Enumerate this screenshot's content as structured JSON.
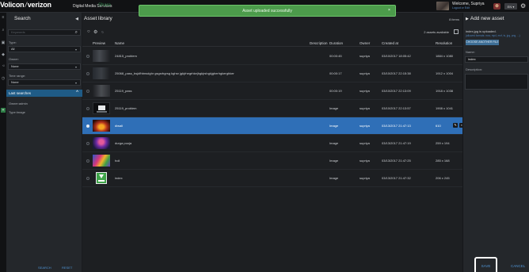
{
  "header": {
    "brand_left": "Volicon",
    "brand_sep": "/",
    "brand_right": "verizon",
    "subtitle": "Digital Media Services",
    "share": "Share",
    "toast": "Asset uploaded successfully",
    "toast_close": "×",
    "welcome": "Welcome, Supriya",
    "welcome_sub": "Logout or Edit",
    "language": "EN ▾",
    "settings_icon": "gear-icon"
  },
  "rail": {
    "icons": [
      "menu-icon",
      "search-icon",
      "chat-icon",
      "tag-icon",
      "share-icon",
      "clock-icon",
      "plus-icon"
    ]
  },
  "search": {
    "title": "Search",
    "keywords_placeholder": "Keywords",
    "type_label": "Type:",
    "type_value": "All",
    "owner_label": "Owner:",
    "owner_value": "None",
    "time_label": "Time range:",
    "time_value": "None",
    "last_searches": "Last searches",
    "last_items": [
      "Owner:admin",
      "Type:Image"
    ],
    "search_button": "SEARCH",
    "reset_button": "RESET"
  },
  "library": {
    "title": "Asset library",
    "items_count": "8 items",
    "assets_available": "2 assets available",
    "columns": {
      "preview": "Preview",
      "name": "Name",
      "description": "Description",
      "duration": "Duration",
      "owner": "Owner",
      "created": "Created at",
      "resolution": "Resolution"
    },
    "rows": [
      {
        "name": "24815_problem",
        "description": "",
        "duration": "00:00:45",
        "owner": "supriya",
        "created": "03/10/2017 18:05:42",
        "resolution": "1884 x 1080",
        "selected": false,
        "thumb": "dark"
      },
      {
        "name": "25068_pass_bsjdfhbnsdghr gsgsrhgrsg kghsr jgkjrhegrhkejhgkjrshgkjgherhgkerghker",
        "description": "",
        "duration": "00:00:17",
        "owner": "supriya",
        "created": "03/10/2017 22:15:38",
        "resolution": "1912 x 1004",
        "selected": false,
        "thumb": "dark"
      },
      {
        "name": "25119_pass",
        "description": "",
        "duration": "00:00:19",
        "owner": "supriya",
        "created": "03/10/2017 22:13:09",
        "resolution": "1918 x 1038",
        "selected": false,
        "thumb": "dark"
      },
      {
        "name": "25119_problem",
        "description": "",
        "duration": "Image",
        "owner": "supriya",
        "created": "03/10/2017 22:13:57",
        "resolution": "1908 x 1041",
        "selected": false,
        "thumb": "screen"
      },
      {
        "name": "diwali",
        "description": "",
        "duration": "Image",
        "owner": "supriya",
        "created": "03/13/2017 21:47:13",
        "resolution": "610",
        "selected": true,
        "thumb": "diwali"
      },
      {
        "name": "durga pooja",
        "description": "",
        "duration": "Image",
        "owner": "supriya",
        "created": "03/13/2017 21:47:19",
        "resolution": "259 x 194",
        "selected": false,
        "thumb": "durga"
      },
      {
        "name": "holi",
        "description": "",
        "duration": "Image",
        "owner": "supriya",
        "created": "03/13/2017 21:47:25",
        "resolution": "285 x 168",
        "selected": false,
        "thumb": "holi"
      },
      {
        "name": "index",
        "description": "",
        "duration": "Image",
        "owner": "supriya",
        "created": "03/13/2017 21:47:32",
        "resolution": "206 x 245",
        "selected": false,
        "thumb": "index"
      }
    ]
  },
  "add_asset": {
    "title": "Add new asset",
    "uploaded": "index.jpg is uploaded.",
    "uploaded_sub": "(allowed formats: mov, mp4, mxf, ts, jpg, png, ...)",
    "choose_button": "CHOOSE ANOTHER FILE",
    "name_label": "Name:",
    "name_value": "index",
    "description_label": "Description:",
    "description_value": "",
    "save_button": "SAVE",
    "cancel_button": "CANCEL"
  }
}
